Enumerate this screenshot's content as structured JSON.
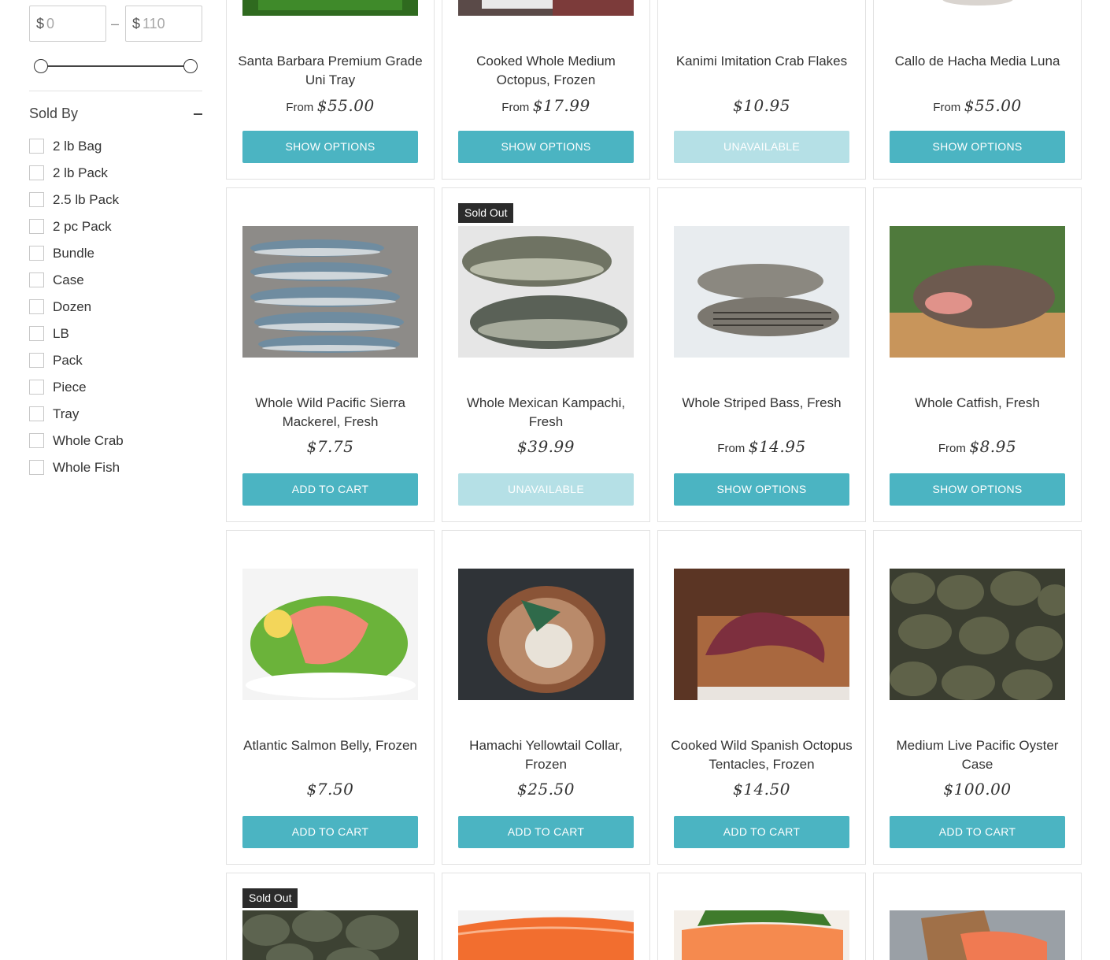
{
  "filters": {
    "price": {
      "currency": "$",
      "min": "0",
      "max": "110",
      "separator": "–"
    },
    "sold_by": {
      "title": "Sold By",
      "options": [
        "2 lb Bag",
        "2 lb Pack",
        "2.5 lb Pack",
        "2 pc Pack",
        "Bundle",
        "Case",
        "Dozen",
        "LB",
        "Pack",
        "Piece",
        "Tray",
        "Whole Crab",
        "Whole Fish"
      ]
    }
  },
  "products": [
    {
      "title": "Santa Barbara Premium Grade Uni Tray",
      "from": "From",
      "price": "$55.00",
      "button": "SHOW OPTIONS",
      "available": true,
      "image": "uni-tray-image"
    },
    {
      "title": "Cooked Whole Medium Octopus, Frozen",
      "from": "From",
      "price": "$17.99",
      "button": "SHOW OPTIONS",
      "available": true,
      "image": "octopus-image"
    },
    {
      "title": "Kanimi Imitation Crab Flakes",
      "from": "",
      "price": "$10.95",
      "button": "UNAVAILABLE",
      "available": false,
      "image": "crab-flakes-image"
    },
    {
      "title": "Callo de Hacha Media Luna",
      "from": "From",
      "price": "$55.00",
      "button": "SHOW OPTIONS",
      "available": true,
      "image": "scallop-image"
    },
    {
      "title": "Whole Wild Pacific Sierra Mackerel, Fresh",
      "from": "",
      "price": "$7.75",
      "button": "ADD TO CART",
      "available": true,
      "image": "mackerel-image"
    },
    {
      "title": "Whole Mexican Kampachi, Fresh",
      "from": "",
      "price": "$39.99",
      "button": "UNAVAILABLE",
      "available": false,
      "badge": "Sold Out",
      "image": "kampachi-image"
    },
    {
      "title": "Whole Striped Bass, Fresh",
      "from": "From",
      "price": "$14.95",
      "button": "SHOW OPTIONS",
      "available": true,
      "image": "striped-bass-image"
    },
    {
      "title": "Whole Catfish, Fresh",
      "from": "From",
      "price": "$8.95",
      "button": "SHOW OPTIONS",
      "available": true,
      "image": "catfish-image"
    },
    {
      "title": "Atlantic Salmon Belly, Frozen",
      "from": "",
      "price": "$7.50",
      "button": "ADD TO CART",
      "available": true,
      "image": "salmon-belly-image"
    },
    {
      "title": "Hamachi Yellowtail Collar, Frozen",
      "from": "",
      "price": "$25.50",
      "button": "ADD TO CART",
      "available": true,
      "image": "hamachi-collar-image"
    },
    {
      "title": "Cooked Wild Spanish Octopus Tentacles, Frozen",
      "from": "",
      "price": "$14.50",
      "button": "ADD TO CART",
      "available": true,
      "image": "octopus-tentacle-image"
    },
    {
      "title": "Medium Live Pacific Oyster Case",
      "from": "",
      "price": "$100.00",
      "button": "ADD TO CART",
      "available": true,
      "image": "oysters-image"
    },
    {
      "badge": "Sold Out",
      "image": "oysters-image-2"
    },
    {
      "image": "salmon-fillet-image"
    },
    {
      "image": "salmon-fillet-image-2"
    },
    {
      "image": "salmon-board-image"
    }
  ],
  "colors": {
    "button": "#4bb4c2",
    "button_disabled": "#b5e0e6",
    "badge": "#2b2b2b"
  }
}
